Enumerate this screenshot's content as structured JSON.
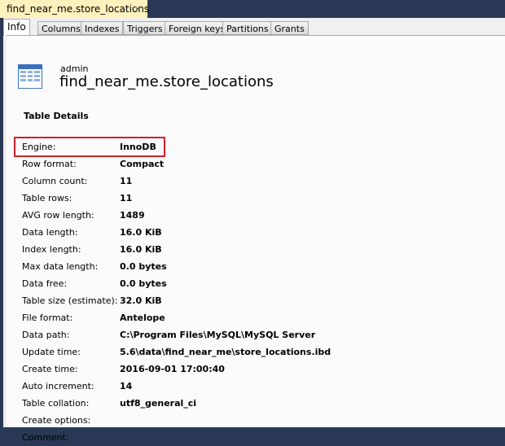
{
  "doc_tab": {
    "label": "find_near_me.store_locations",
    "close": "×"
  },
  "tabs": [
    "Info",
    "Columns",
    "Indexes",
    "Triggers",
    "Foreign keys",
    "Partitions",
    "Grants"
  ],
  "header": {
    "owner": "admin",
    "title": "find_near_me.store_locations"
  },
  "section_title": "Table Details",
  "details": [
    {
      "label": "Engine:",
      "value": "InnoDB"
    },
    {
      "label": "Row format:",
      "value": "Compact"
    },
    {
      "label": "Column count:",
      "value": "11"
    },
    {
      "label": "Table rows:",
      "value": "11"
    },
    {
      "label": "AVG row length:",
      "value": "1489"
    },
    {
      "label": "Data length:",
      "value": "16.0 KiB"
    },
    {
      "label": "Index length:",
      "value": "16.0 KiB"
    },
    {
      "label": "Max data length:",
      "value": "0.0 bytes"
    },
    {
      "label": "Data free:",
      "value": "0.0 bytes"
    },
    {
      "label": "Table size (estimate):",
      "value": "32.0 KiB"
    },
    {
      "label": "File format:",
      "value": "Antelope"
    },
    {
      "label": "Data path:",
      "value": "C:\\Program Files\\MySQL\\MySQL Server 5.6\\data\\find_near_me\\store_locations.ibd"
    },
    {
      "label": "Update time:",
      "value": ""
    },
    {
      "label": "Create time:",
      "value": "2016-09-01 17:00:40"
    },
    {
      "label": "Auto increment:",
      "value": "14"
    },
    {
      "label": "Table collation:",
      "value": "utf8_general_ci"
    },
    {
      "label": "Create options:",
      "value": ""
    },
    {
      "label": "Comment:",
      "value": ""
    }
  ]
}
